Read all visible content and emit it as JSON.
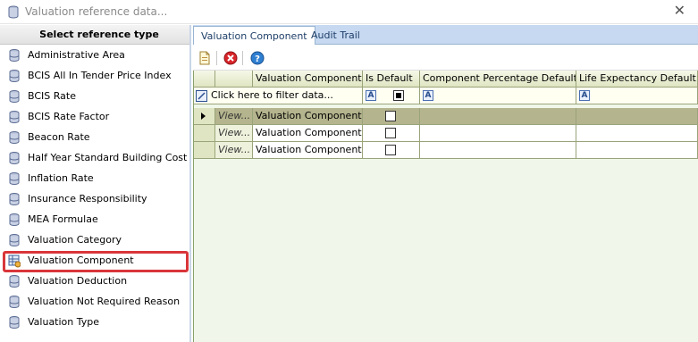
{
  "window": {
    "title": "Valuation reference data...",
    "close_glyph": "✕"
  },
  "left_panel": {
    "header": "Select reference type",
    "items": [
      {
        "label": "Administrative Area"
      },
      {
        "label": "BCIS All In Tender Price Index"
      },
      {
        "label": "BCIS Rate"
      },
      {
        "label": "BCIS Rate Factor"
      },
      {
        "label": "Beacon Rate"
      },
      {
        "label": "Half Year Standard Building Cost"
      },
      {
        "label": "Inflation Rate"
      },
      {
        "label": "Insurance Responsibility"
      },
      {
        "label": "MEA Formulae"
      },
      {
        "label": "Valuation Category"
      },
      {
        "label": "Valuation Component",
        "selected": true
      },
      {
        "label": "Valuation Deduction"
      },
      {
        "label": "Valuation Not Required Reason"
      },
      {
        "label": "Valuation Type"
      }
    ]
  },
  "tabs": [
    {
      "label": "Valuation Component",
      "active": true
    },
    {
      "label": "Audit Trail",
      "active": false
    }
  ],
  "toolbar": {
    "buttons": [
      {
        "icon": "new-document-icon"
      },
      {
        "icon": "delete-icon"
      },
      {
        "icon": "help-icon"
      }
    ]
  },
  "grid": {
    "columns": [
      "Valuation Component",
      "Is Default",
      "Component Percentage Default",
      "Life Expectancy Default"
    ],
    "filter_text": "Click here to filter data...",
    "filter_icon_letter": "A",
    "rows": [
      {
        "view": "View...",
        "valuation_component": "Valuation Component",
        "is_default": false,
        "active": true
      },
      {
        "view": "View...",
        "valuation_component": "Valuation Component",
        "is_default": false,
        "active": false
      },
      {
        "view": "View...",
        "valuation_component": "Valuation Component",
        "is_default": false,
        "active": false
      }
    ]
  },
  "colors": {
    "selection_outline": "#d9363a",
    "tab_strip": "#c6d9f1",
    "active_row": "#b4b48e"
  }
}
